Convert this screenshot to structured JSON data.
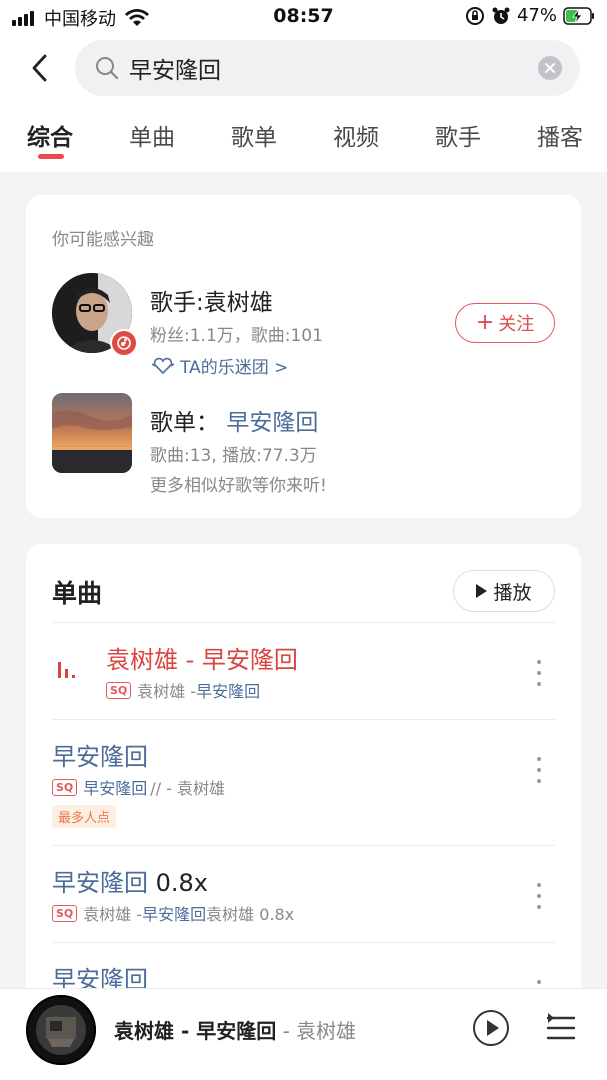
{
  "status_bar": {
    "carrier": "中国移动",
    "time": "08:57",
    "battery": "47%"
  },
  "search": {
    "query": "早安隆回"
  },
  "tabs": [
    {
      "label": "综合",
      "active": true
    },
    {
      "label": "单曲",
      "active": false
    },
    {
      "label": "歌单",
      "active": false
    },
    {
      "label": "视频",
      "active": false
    },
    {
      "label": "歌手",
      "active": false
    },
    {
      "label": "播客",
      "active": false
    }
  ],
  "suggest": {
    "title": "你可能感兴趣",
    "artist": {
      "title": "歌手:袁树雄",
      "meta": "粉丝:1.1万，歌曲:101",
      "fanclub": "TA的乐迷团 >",
      "follow_label": "关注"
    },
    "playlist": {
      "label": "歌单：",
      "name": "早安隆回",
      "meta": "歌曲:13, 播放:77.3万",
      "desc": "更多相似好歌等你来听!"
    }
  },
  "songs_section": {
    "title": "单曲",
    "play_label": "播放",
    "items": [
      {
        "title": "袁树雄 - 早安隆回",
        "quality": "SQ",
        "artist": "袁树雄 - ",
        "album": "早安隆回",
        "playing": true
      },
      {
        "title": "早安隆回",
        "quality": "SQ",
        "highlight": "早安隆回",
        "rest": "// - 袁树雄",
        "tag": "最多人点"
      },
      {
        "title": "早安隆回",
        "title_suffix": " 0.8x",
        "quality": "SQ",
        "artist": "袁树雄 - ",
        "album": "早安隆回",
        "rest": " 袁树雄 0.8x"
      },
      {
        "title": "早安隆回"
      }
    ]
  },
  "player": {
    "song": "袁树雄 - 早安隆回",
    "artist": " - 袁树雄"
  },
  "colors": {
    "accent": "#ea4a55",
    "link": "#4c6d9a",
    "playing": "#d9453f"
  }
}
